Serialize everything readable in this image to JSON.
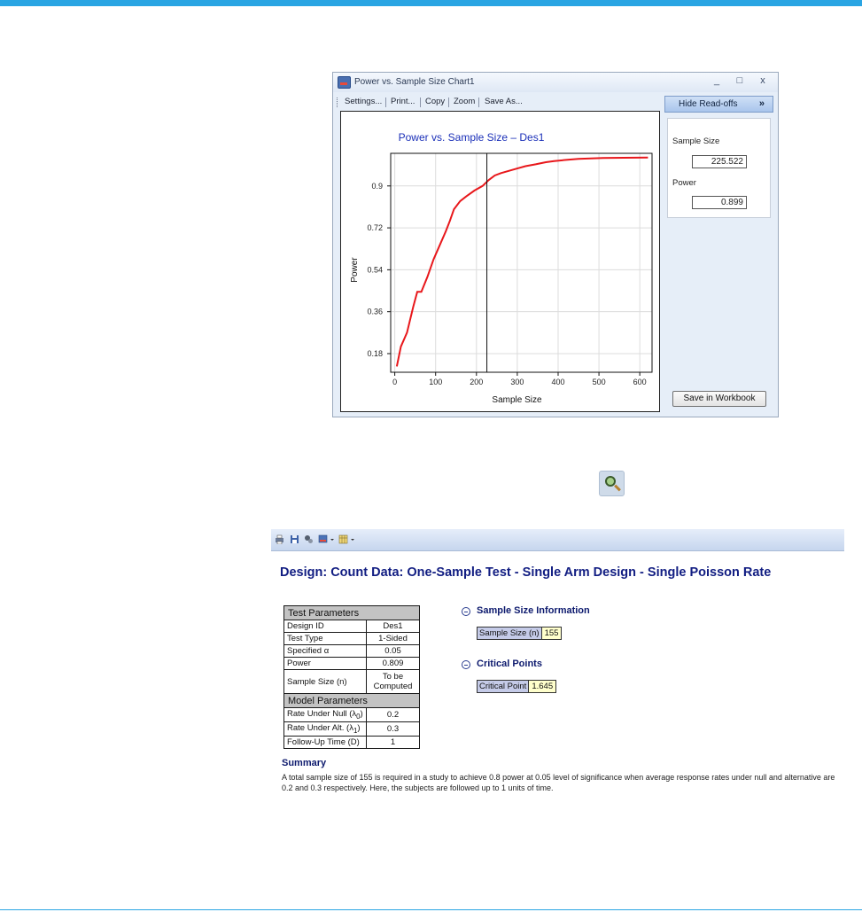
{
  "chart_window": {
    "title": "Power vs. Sample Size Chart1",
    "controls": {
      "minimize": "_",
      "maximize": "□",
      "close": "x"
    },
    "toolbar": [
      "Settings...",
      "Print...",
      "Copy",
      "Zoom",
      "Save As..."
    ],
    "hide_readoffs_label": "Hide Read-offs",
    "hide_readoffs_chevron": "»",
    "readoffs": {
      "sample_size_label": "Sample Size",
      "sample_size_value": "225.522",
      "power_label": "Power",
      "power_value": "0.899"
    },
    "save_button": "Save in Workbook"
  },
  "chart_data": {
    "type": "line",
    "title": "Power vs. Sample Size – Des1",
    "xlabel": "Sample Size",
    "ylabel": "Power",
    "xlim": [
      -10,
      630
    ],
    "ylim": [
      0.1,
      1.04
    ],
    "x_ticks": [
      0,
      100,
      200,
      300,
      400,
      500,
      600
    ],
    "y_ticks": [
      0.18,
      0.36,
      0.54,
      0.72,
      0.9
    ],
    "y_tick_labels": [
      "0.18",
      "0.36",
      "0.54",
      "0.72",
      "0.9"
    ],
    "grid": true,
    "series_color": "#e8171b",
    "marker_x": 225.522,
    "series": [
      {
        "x": [
          5,
          15,
          30,
          45,
          55,
          65,
          80,
          95,
          110,
          125,
          135,
          145,
          160,
          175,
          195,
          215,
          230,
          245,
          260,
          280,
          300,
          320,
          345,
          370,
          390,
          420,
          450,
          480,
          510,
          560,
          620
        ],
        "y": [
          0.125,
          0.21,
          0.27,
          0.38,
          0.445,
          0.445,
          0.51,
          0.585,
          0.645,
          0.705,
          0.75,
          0.8,
          0.835,
          0.855,
          0.88,
          0.9,
          0.925,
          0.945,
          0.955,
          0.965,
          0.975,
          0.985,
          0.993,
          1.002,
          1.007,
          1.012,
          1.016,
          1.018,
          1.02,
          1.021,
          1.022
        ]
      }
    ]
  },
  "report": {
    "title": "Design: Count Data: One-Sample Test - Single Arm Design - Single Poisson Rate",
    "test_params_header": "Test Parameters",
    "test_params": [
      {
        "key": "Design ID",
        "value": "Des1"
      },
      {
        "key": "Test Type",
        "value": "1-Sided"
      },
      {
        "key": "Specified α",
        "value": "0.05"
      },
      {
        "key": "Power",
        "value": "0.809"
      },
      {
        "key": "Sample Size (n)",
        "value": "To be Computed"
      }
    ],
    "model_params_header": "Model Parameters",
    "model_params": [
      {
        "key": "Rate Under Null (λ",
        "sub": "0",
        "value": "0.2"
      },
      {
        "key": "Rate Under Alt. (λ",
        "sub": "1",
        "value": "0.3"
      },
      {
        "key": "Follow-Up Time (D)",
        "sub": "",
        "value": "1"
      }
    ],
    "sample_size_info": {
      "heading": "Sample Size Information",
      "label": "Sample Size (n)",
      "value": "155"
    },
    "critical_points": {
      "heading": "Critical Points",
      "label": "Critical Point",
      "value": "1.645"
    },
    "summary_heading": "Summary",
    "summary_text": "A total sample size of 155 is required in a study to achieve 0.8 power at 0.05 level of significance when average response rates under null and alternative are 0.2 and 0.3 respectively. Here, the subjects are followed up to 1 units of time."
  }
}
